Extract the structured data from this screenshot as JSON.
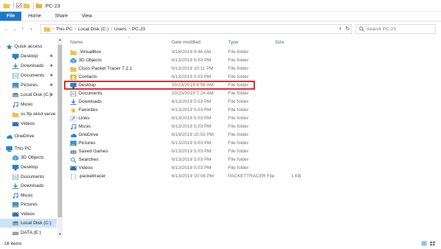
{
  "window": {
    "title": "PC-23"
  },
  "ribbon": {
    "tabs": [
      "File",
      "Home",
      "Share",
      "View"
    ]
  },
  "address": {
    "crumbs": [
      "This PC",
      "Local Disk (C:)",
      "Users",
      "PC-23"
    ]
  },
  "search": {
    "placeholder": "Search PC-23"
  },
  "nav": {
    "items": [
      {
        "label": "Quick access"
      },
      {
        "label": "Desktop"
      },
      {
        "label": "Downloads"
      },
      {
        "label": "Documents"
      },
      {
        "label": "Pictures"
      },
      {
        "label": "Local Disk (C:)"
      },
      {
        "label": "Music"
      },
      {
        "label": "ss ftp wind serve"
      },
      {
        "label": "Videos"
      },
      {
        "label": "OneDrive"
      },
      {
        "label": "This PC"
      },
      {
        "label": "3D Objects"
      },
      {
        "label": "Desktop"
      },
      {
        "label": "Documents"
      },
      {
        "label": "Downloads"
      },
      {
        "label": "Music"
      },
      {
        "label": "Pictures"
      },
      {
        "label": "Videos"
      },
      {
        "label": "Local Disk (C:)"
      },
      {
        "label": "DATA (E:)"
      }
    ]
  },
  "columns": {
    "name": "Name",
    "date": "Date modified",
    "type": "Type",
    "size": "Size"
  },
  "files": [
    {
      "name": ".VirtualBox",
      "date": "9/18/2019 8:46 AM",
      "type": "File folder",
      "size": ""
    },
    {
      "name": "3D Objects",
      "date": "6/13/2019 5:03 PM",
      "type": "File folder",
      "size": ""
    },
    {
      "name": "Cisco Packet Tracer 7.2.1",
      "date": "6/13/2019 10:11 PM",
      "type": "File folder",
      "size": ""
    },
    {
      "name": "Contacts",
      "date": "6/13/2019 5:03 PM",
      "type": "File folder",
      "size": ""
    },
    {
      "name": "Desktop",
      "date": "10/23/2019 8:59 AM",
      "type": "File folder",
      "size": ""
    },
    {
      "name": "Documents",
      "date": "10/23/2019 7:24 AM",
      "type": "File folder",
      "size": ""
    },
    {
      "name": "Downloads",
      "date": "6/13/2019 5:03 PM",
      "type": "File folder",
      "size": ""
    },
    {
      "name": "Favorites",
      "date": "6/13/2019 5:03 PM",
      "type": "File folder",
      "size": ""
    },
    {
      "name": "Links",
      "date": "6/13/2019 5:03 PM",
      "type": "File folder",
      "size": ""
    },
    {
      "name": "Music",
      "date": "6/13/2019 5:03 PM",
      "type": "File folder",
      "size": ""
    },
    {
      "name": "OneDrive",
      "date": "6/19/2019 10:55 PM",
      "type": "File folder",
      "size": ""
    },
    {
      "name": "Pictures",
      "date": "6/13/2019 5:03 PM",
      "type": "File folder",
      "size": ""
    },
    {
      "name": "Saved Games",
      "date": "6/13/2019 5:03 PM",
      "type": "File folder",
      "size": ""
    },
    {
      "name": "Searches",
      "date": "6/13/2019 5:03 PM",
      "type": "File folder",
      "size": ""
    },
    {
      "name": "Videos",
      "date": "6/13/2019 5:03 PM",
      "type": "File folder",
      "size": ""
    },
    {
      "name": ".packettracer",
      "date": "6/13/2019 10:08 PM",
      "type": "PACKETTRACER File",
      "size": "1 KB"
    }
  ],
  "status": {
    "count": "16 items"
  },
  "colors": {
    "file_tab": "#1979ca",
    "selection": "#cce4f7",
    "highlight_box": "#e21b1b",
    "folder": "#f0c24b"
  }
}
